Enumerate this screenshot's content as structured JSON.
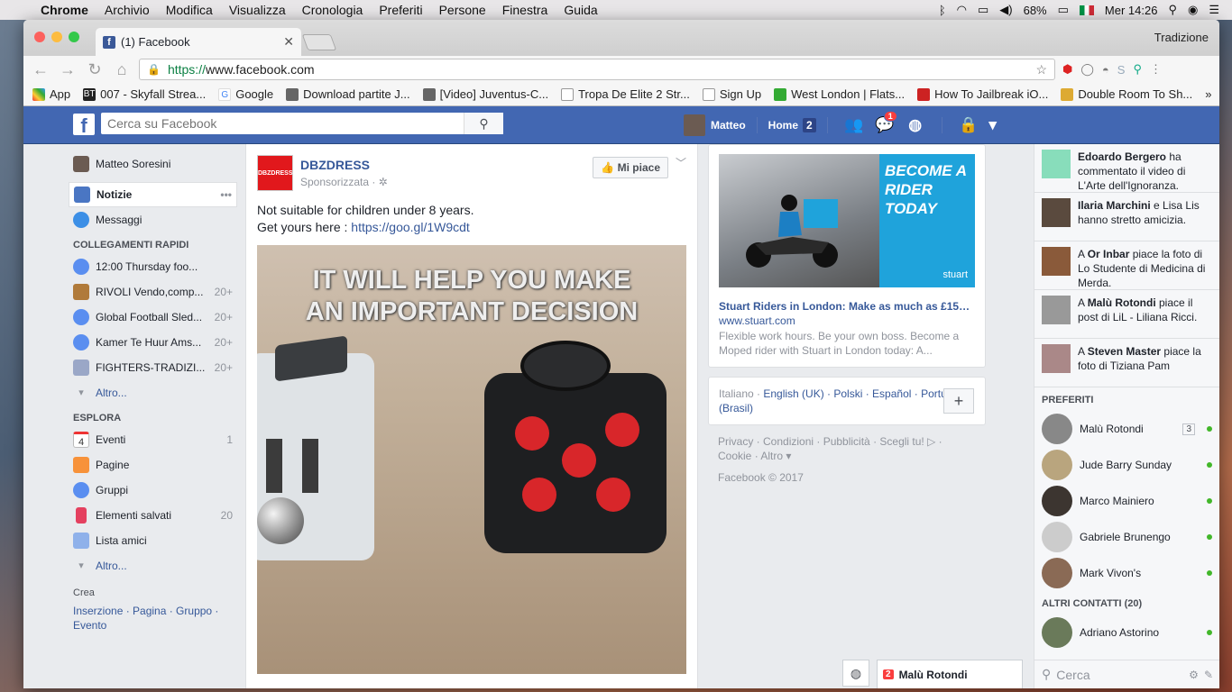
{
  "menubar": {
    "app": "Chrome",
    "items": [
      "Archivio",
      "Modifica",
      "Visualizza",
      "Cronologia",
      "Preferiti",
      "Persone",
      "Finestra",
      "Guida"
    ],
    "battery": "68%",
    "clock": "Mer 14:26"
  },
  "browser": {
    "tab_title": "(1) Facebook",
    "profile": "Tradizione",
    "url_scheme": "https://",
    "url_host": "www.facebook.com",
    "bookmarks": [
      "App",
      "007 - Skyfall Strea...",
      "Google",
      "Download partite J...",
      "[Video] Juventus-C...",
      "Tropa De Elite 2 Str...",
      "Sign Up",
      "West London | Flats...",
      "How To Jailbreak iO...",
      "Double Room To Sh..."
    ],
    "bookmarks_more": "»"
  },
  "fb": {
    "logo": "f",
    "search_placeholder": "Cerca su Facebook",
    "user": "Matteo",
    "home_label": "Home",
    "home_count": "2",
    "messages_badge": "1"
  },
  "left": {
    "profile": "Matteo Soresini",
    "main": [
      {
        "label": "Notizie",
        "more": "•••"
      },
      {
        "label": "Messaggi"
      }
    ],
    "shortcuts_title": "COLLEGAMENTI RAPIDI",
    "shortcuts": [
      {
        "label": "12:00 Thursday foo...",
        "count": ""
      },
      {
        "label": "RIVOLI Vendo,comp...",
        "count": "20+"
      },
      {
        "label": "Global Football Sled...",
        "count": "20+"
      },
      {
        "label": "Kamer Te Huur Ams...",
        "count": "20+"
      },
      {
        "label": "FIGHTERS-TRADIZI...",
        "count": "20+"
      }
    ],
    "more1": "Altro...",
    "explore_title": "ESPLORA",
    "explore": [
      {
        "label": "Eventi",
        "count": "1",
        "icon_text": "4"
      },
      {
        "label": "Pagine",
        "count": ""
      },
      {
        "label": "Gruppi",
        "count": ""
      },
      {
        "label": "Elementi salvati",
        "count": "20"
      },
      {
        "label": "Lista amici",
        "count": ""
      }
    ],
    "more2": "Altro...",
    "create_title": "Crea",
    "create_links": "Inserzione · Pagina · Gruppo · Evento"
  },
  "post": {
    "page_name": "DBZDRESS",
    "logo_text": "DBZDRESS",
    "sponsored": "Sponsorizzata · ✲",
    "like_label": "Mi piace",
    "text_line1": "Not suitable for children under 8 years.",
    "text_line2_prefix": "Get yours here : ",
    "link": "https://goo.gl/1W9cdt",
    "image_caption_1": "IT WILL HELP YOU MAKE",
    "image_caption_2": "AN IMPORTANT DECISION"
  },
  "ad": {
    "banner": "BECOME A RIDER TODAY",
    "brand": "stuart",
    "title": "Stuart Riders in London: Make as much as £150 ...",
    "domain": "www.stuart.com",
    "desc": "Flexible work hours. Be your own boss. Become a Moped rider with Stuart in London today: A..."
  },
  "languages": {
    "current": "Italiano · ",
    "links": "English (UK) · Polski · Español · Português (Brasil)",
    "plus": "+"
  },
  "footer": {
    "links": "Privacy · Condizioni · Pubblicità · Scegli tu! ▷ · Cookie · Altro ▾",
    "copyright": "Facebook © 2017"
  },
  "ticker": [
    {
      "name": "Edoardo Bergero",
      "text": " ha commentato il video di L'Arte dell'Ignoranza."
    },
    {
      "name": "Ilaria Marchini",
      "text": " e Lisa Lis hanno stretto amicizia."
    },
    {
      "prefix": "A ",
      "name": "Or Inbar",
      "text": " piace la foto di Lo Studente di Medicina di Merda."
    },
    {
      "prefix": "A ",
      "name": "Malù Rotondi",
      "text": " piace il post di LiL - Liliana Ricci."
    },
    {
      "prefix": "A ",
      "name": "Steven Master",
      "text": " piace la foto di Tiziana Pam"
    }
  ],
  "favorites_title": "PREFERITI",
  "favorites": [
    {
      "name": "Malù Rotondi",
      "count": "3"
    },
    {
      "name": "Jude Barry Sunday"
    },
    {
      "name": "Marco Mainiero"
    },
    {
      "name": "Gabriele Brunengo"
    },
    {
      "name": "Mark Vivon's"
    }
  ],
  "others_title": "ALTRI CONTATTI (20)",
  "others": [
    {
      "name": "Adriano Astorino"
    }
  ],
  "chat_search_placeholder": "Cerca",
  "chat_tab": {
    "count": "2",
    "name": "Malù Rotondi"
  }
}
